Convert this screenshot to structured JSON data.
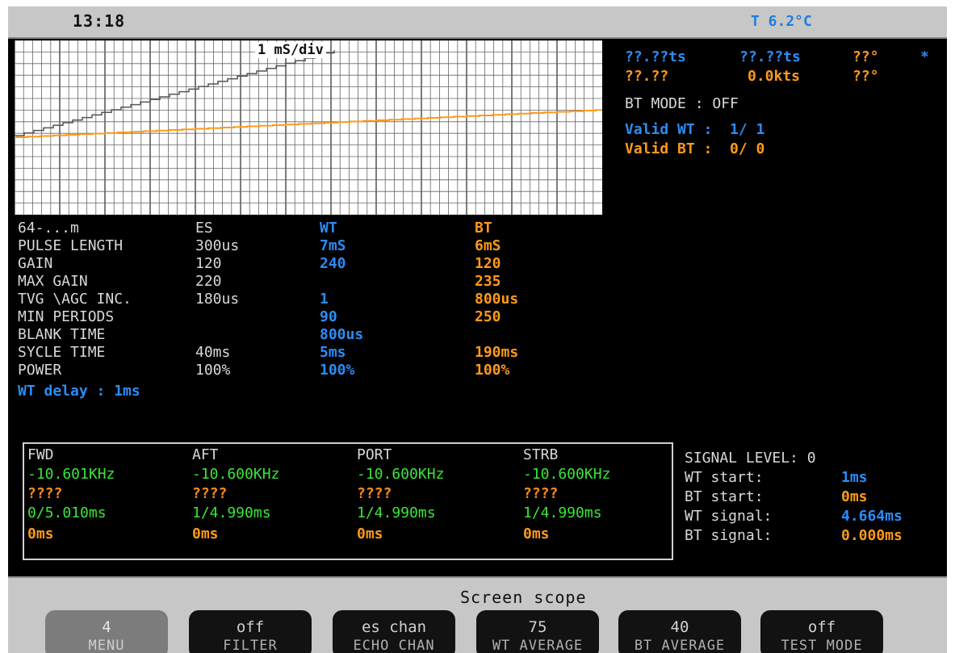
{
  "status_bar": {
    "time": "13:18",
    "temperature": "T  6.2°C"
  },
  "scope": {
    "timebase": "1 mS/div"
  },
  "nav": {
    "row1": [
      "??.??ts",
      "??.??ts",
      "??°",
      "*"
    ],
    "row2": [
      "??.??",
      "0.0kts",
      "??°"
    ],
    "bt_mode": "BT MODE : OFF",
    "valid_wt": "Valid WT :  1/ 1",
    "valid_bt": "Valid BT :  0/ 0"
  },
  "params": {
    "headers": [
      "64-...m",
      "ES",
      "WT",
      "BT"
    ],
    "rows": [
      {
        "label": "PULSE LENGTH",
        "es": "300us",
        "wt": "7mS",
        "bt": "6mS"
      },
      {
        "label": "GAIN",
        "es": "120",
        "wt": "240",
        "bt": "120"
      },
      {
        "label": "MAX GAIN",
        "es": "220",
        "wt": "",
        "bt": "235"
      },
      {
        "label": "TVG \\AGC INC.",
        "es": "180us",
        "wt": "1",
        "bt": "800us"
      },
      {
        "label": "MIN PERIODS",
        "es": "",
        "wt": "90",
        "bt": "250"
      },
      {
        "label": "BLANK TIME",
        "es": "",
        "wt": "800us",
        "bt": ""
      },
      {
        "label": "SYCLE TIME",
        "es": "40ms",
        "wt": "5ms",
        "bt": "190ms"
      },
      {
        "label": "POWER",
        "es": "100%",
        "wt": "100%",
        "bt": "100%"
      }
    ],
    "wt_delay": "WT delay : 1ms"
  },
  "channels": [
    {
      "name": "FWD",
      "freq": "-10.601KHz",
      "unknown": "????",
      "timing": "0/5.010ms",
      "delay": "0ms"
    },
    {
      "name": "AFT",
      "freq": "-10.600KHz",
      "unknown": "????",
      "timing": "1/4.990ms",
      "delay": "0ms"
    },
    {
      "name": "PORT",
      "freq": "-10.600KHz",
      "unknown": "????",
      "timing": "1/4.990ms",
      "delay": "0ms"
    },
    {
      "name": "STRB",
      "freq": "-10.600KHz",
      "unknown": "????",
      "timing": "1/4.990ms",
      "delay": "0ms"
    }
  ],
  "signal": {
    "level": "SIGNAL LEVEL: 0",
    "rows": [
      {
        "label": "WT start:",
        "value": "1ms"
      },
      {
        "label": "BT start:",
        "value": "0ms"
      },
      {
        "label": "WT signal:",
        "value": "4.664ms"
      },
      {
        "label": "BT signal:",
        "value": "0.000ms"
      }
    ]
  },
  "footer": {
    "screen_name": "Screen  scope",
    "softkeys": [
      {
        "value": "4",
        "label": "MENU"
      },
      {
        "value": "off",
        "label": "FILTER"
      },
      {
        "value": "es chan",
        "label": "ECHO CHAN"
      },
      {
        "value": "75",
        "label": "WT AVERAGE"
      },
      {
        "value": "40",
        "label": "BT AVERAGE"
      },
      {
        "value": "off",
        "label": "TEST MODE"
      }
    ]
  },
  "colors": {
    "blue": "#2b8cf5",
    "orange": "#ff9a1a",
    "green": "#39e639",
    "screen": "#000000",
    "bezel": "#c7c7c7"
  }
}
